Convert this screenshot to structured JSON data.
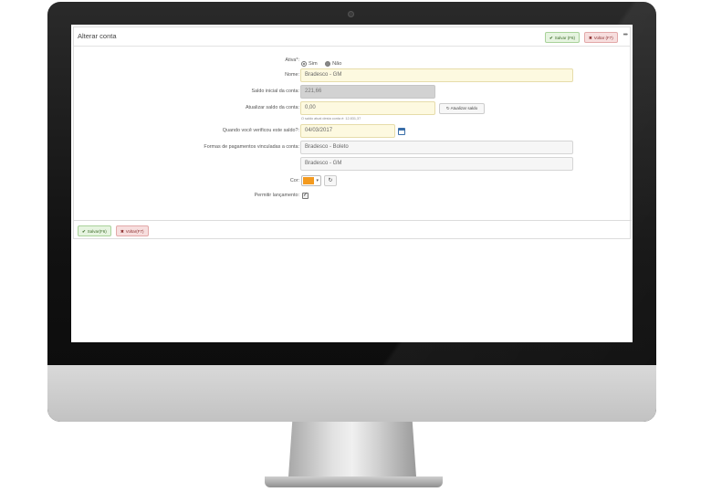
{
  "header": {
    "title": "Alterar conta",
    "save_label": "Salvar (F6)",
    "back_label": "Voltar (F7)",
    "more_label": "•••"
  },
  "form": {
    "ativa": {
      "label": "Ativa*:",
      "option_yes": "Sim",
      "option_no": "Não",
      "selected": "Sim"
    },
    "nome": {
      "label": "Nome:",
      "value": "Bradesco - GM"
    },
    "saldo_inicial": {
      "label": "Saldo inicial da conta:",
      "value": "221,66"
    },
    "atualizar_saldo": {
      "label": "Atualizar saldo da conta:",
      "value": "0,00",
      "button": "Atualizar saldo",
      "hint": "O saldo atual desta conta é: 12.831,37"
    },
    "data_verificacao": {
      "label": "Quando você verificou este saldo?:",
      "value": "04/03/2017"
    },
    "formas_pagamento": {
      "label": "Formas de pagamentos vinculadas a conta:",
      "items": [
        "Bradesco - Boleto",
        "Bradesco - GM"
      ]
    },
    "cor": {
      "label": "Cor:",
      "value": "#f39a1f"
    },
    "permitir_lancamento": {
      "label": "Permitir lançamento:",
      "checked": true
    }
  },
  "footer": {
    "save_label": "Salvar(F6)",
    "back_label": "Voltar(F7)"
  },
  "icons": {
    "check": "✔",
    "close": "✖",
    "refresh": "↻",
    "caret": "▾",
    "checkmark": "✓"
  },
  "colors": {
    "save_bg": "#e6f4e0",
    "back_bg": "#f7dede",
    "required_bg": "#fdf9e0",
    "readonly_bg": "#d2d2d2",
    "accent": "#f39a1f"
  }
}
